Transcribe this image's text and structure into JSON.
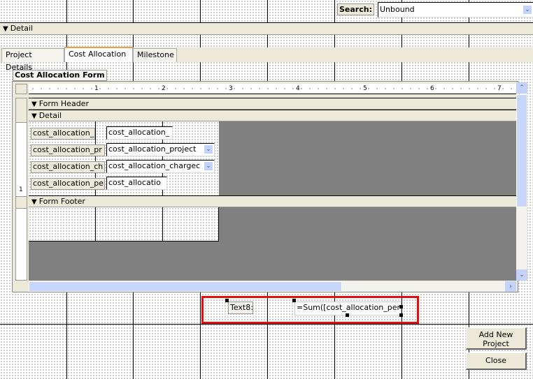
{
  "header": {
    "search_label": "Search:",
    "search_value": "Unbound"
  },
  "sections": {
    "detail": "Detail"
  },
  "tabs": [
    {
      "label": "Project Details"
    },
    {
      "label": "Cost Allocation"
    },
    {
      "label": "Milestone"
    }
  ],
  "subform": {
    "label": "Cost Allocation Form",
    "ruler": [
      "1",
      "2",
      "3",
      "4",
      "5",
      "6",
      "7"
    ],
    "vruler": [
      "1"
    ],
    "form_header": "Form Header",
    "detail": "Detail",
    "form_footer": "Form Footer",
    "fields": [
      {
        "label": "cost_allocation_",
        "control": "cost_allocation_",
        "type": "textbox"
      },
      {
        "label": "cost_allocation_pr",
        "control": "cost_allocation_project",
        "type": "combo"
      },
      {
        "label": "cost_allocation_ch",
        "control": "cost_allocation_chargec",
        "type": "combo"
      },
      {
        "label": "cost_allocation_pe",
        "control": "cost_allocatio",
        "type": "textbox"
      }
    ]
  },
  "footer_controls": {
    "text_label": "Text8:",
    "text_value": "=Sum([cost_allocation_percent"
  },
  "buttons": {
    "add_new": "Add New Project",
    "close": "Close"
  },
  "colors": {
    "highlight": "#E01010",
    "band": "#ECE9D8",
    "scroll": "#C3D3FD"
  }
}
